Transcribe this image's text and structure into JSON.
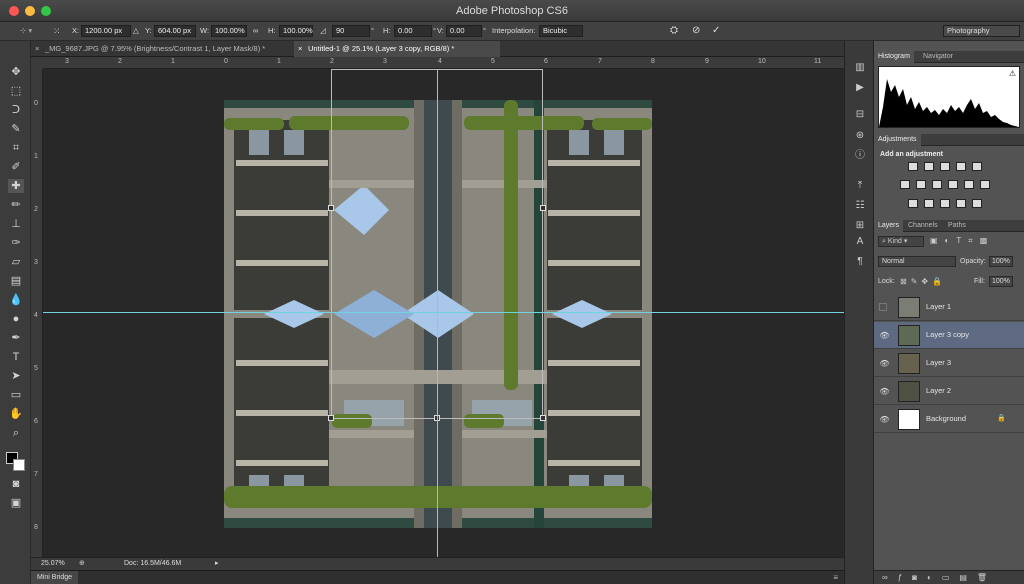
{
  "window": {
    "title": "Adobe Photoshop CS6",
    "workspace": "Photography"
  },
  "options": {
    "x_label": "X:",
    "x_value": "1200.00 px",
    "y_label": "Y:",
    "y_value": "604.00 px",
    "w_label": "W:",
    "w_value": "100.00%",
    "h_label": "H:",
    "h_value": "100.00%",
    "angle_value": "90",
    "h_skew_label": "H:",
    "h_skew_value": "0.00",
    "v_skew_label": "V:",
    "v_skew_value": "0.00",
    "degree_symbol": "°",
    "interpolation_label": "Interpolation:",
    "interpolation_value": "Bicubic"
  },
  "tabs": [
    {
      "label": "_MG_9687.JPG @ 7.95% (Brightness/Contrast 1, Layer Mask/8) *"
    },
    {
      "label": "Untitled-1 @ 25.1% (Layer 3 copy, RGB/8) *"
    }
  ],
  "ruler_h": [
    "3",
    "2",
    "1",
    "0",
    "1",
    "2",
    "3",
    "4",
    "5",
    "6",
    "7",
    "8",
    "9",
    "10",
    "11"
  ],
  "ruler_v": [
    "0",
    "1",
    "2",
    "3",
    "4",
    "5",
    "6",
    "7",
    "8"
  ],
  "status": {
    "zoom": "25.07%",
    "doc": "Doc: 16.5M/46.6M"
  },
  "minibridge": {
    "label": "Mini Bridge"
  },
  "panels": {
    "histogram_tab": "Histogram",
    "navigator_tab": "Navigator",
    "adjustments_tab": "Adjustments",
    "adjustments_title": "Add an adjustment",
    "layers_tab": "Layers",
    "channels_tab": "Channels",
    "paths_tab": "Paths",
    "kind_label": "Kind",
    "blend_mode": "Normal",
    "opacity_label": "Opacity:",
    "opacity_value": "100%",
    "lock_label": "Lock:",
    "fill_label": "Fill:",
    "fill_value": "100%"
  },
  "layers": [
    {
      "name": "Layer 1"
    },
    {
      "name": "Layer 3 copy"
    },
    {
      "name": "Layer 3"
    },
    {
      "name": "Layer 2"
    },
    {
      "name": "Background"
    }
  ],
  "icons": {
    "tools": [
      "move-icon",
      "marquee-icon",
      "lasso-icon",
      "quick-select-icon",
      "crop-icon",
      "eyedropper-icon",
      "healing-icon",
      "brush-icon",
      "clone-stamp-icon",
      "history-brush-icon",
      "eraser-icon",
      "gradient-icon",
      "blur-icon",
      "dodge-icon",
      "pen-icon",
      "type-icon",
      "path-select-icon",
      "shape-icon",
      "hand-icon",
      "zoom-icon"
    ],
    "accent": "#6fd3e0",
    "selected_layer": "#5d6a82"
  }
}
